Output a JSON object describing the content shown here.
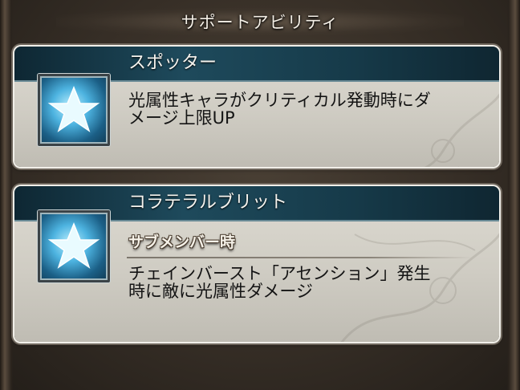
{
  "header": {
    "title": "サポートアビリティ"
  },
  "abilities": [
    {
      "name": "スポッター",
      "icon": "star-icon",
      "description_lines": [
        "光属性キャラがクリティカル発動時にダ",
        "メージ上限UP"
      ]
    },
    {
      "name": "コラテラルブリット",
      "icon": "star-icon",
      "condition": "サブメンバー時",
      "description_lines": [
        "チェインバースト「アセンション」発生",
        "時に敵に光属性ダメージ"
      ]
    }
  ],
  "colors": {
    "title_bar": "#1e4a5c",
    "card_bg": "#d6d3ca",
    "icon_glow": "#4db3e0",
    "frame": "#362e26"
  }
}
